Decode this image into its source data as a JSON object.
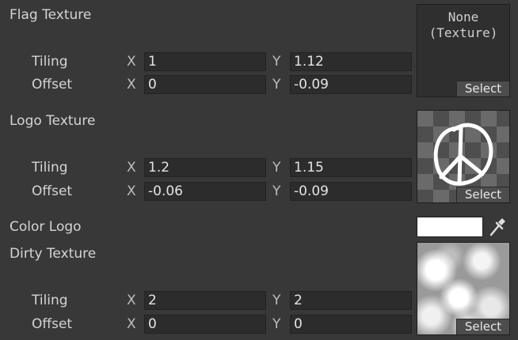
{
  "sections": [
    {
      "title": "Flag Texture",
      "tiling_label": "Tiling",
      "offset_label": "Offset",
      "tiling": {
        "x_label": "X",
        "x": "1",
        "y_label": "Y",
        "y": "1.12"
      },
      "offset": {
        "x_label": "X",
        "x": "0",
        "y_label": "Y",
        "y": "-0.09"
      },
      "slot": {
        "none_text_line1": "None",
        "none_text_line2": "(Texture)",
        "select_label": "Select"
      }
    },
    {
      "title": "Logo Texture",
      "tiling_label": "Tiling",
      "offset_label": "Offset",
      "tiling": {
        "x_label": "X",
        "x": "1.2",
        "y_label": "Y",
        "y": "1.15"
      },
      "offset": {
        "x_label": "X",
        "x": "-0.06",
        "y_label": "Y",
        "y": "-0.09"
      },
      "slot": {
        "preview_icon": "peace-sign-icon",
        "select_label": "Select"
      }
    },
    {
      "title": "Dirty Texture",
      "tiling_label": "Tiling",
      "offset_label": "Offset",
      "tiling": {
        "x_label": "X",
        "x": "2",
        "y_label": "Y",
        "y": "2"
      },
      "offset": {
        "x_label": "X",
        "x": "0",
        "y_label": "Y",
        "y": "0"
      },
      "slot": {
        "preview": "cloud-noise-texture",
        "select_label": "Select"
      }
    }
  ],
  "color_logo": {
    "label": "Color Logo",
    "value": "#ffffff",
    "picker_icon": "eyedropper-icon"
  }
}
